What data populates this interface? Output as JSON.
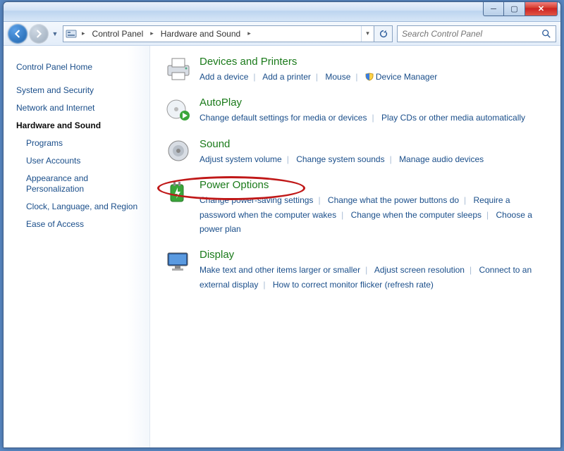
{
  "window": {
    "min": "─",
    "max": "▢",
    "close": "✕"
  },
  "address": {
    "seg1": "Control Panel",
    "seg2": "Hardware and Sound"
  },
  "search": {
    "placeholder": "Search Control Panel"
  },
  "sidebar": {
    "home": "Control Panel Home",
    "items": [
      "System and Security",
      "Network and Internet",
      "Hardware and Sound",
      "Programs",
      "User Accounts",
      "Appearance and Personalization",
      "Clock, Language, and Region",
      "Ease of Access"
    ]
  },
  "categories": [
    {
      "title": "Devices and Printers",
      "tasks": [
        "Add a device",
        "Add a printer",
        "Mouse",
        "Device Manager"
      ],
      "shield_on": [
        3
      ]
    },
    {
      "title": "AutoPlay",
      "tasks": [
        "Change default settings for media or devices",
        "Play CDs or other media automatically"
      ]
    },
    {
      "title": "Sound",
      "tasks": [
        "Adjust system volume",
        "Change system sounds",
        "Manage audio devices"
      ]
    },
    {
      "title": "Power Options",
      "tasks": [
        "Change power-saving settings",
        "Change what the power buttons do",
        "Require a password when the computer wakes",
        "Change when the computer sleeps",
        "Choose a power plan"
      ],
      "highlight": true
    },
    {
      "title": "Display",
      "tasks": [
        "Make text and other items larger or smaller",
        "Adjust screen resolution",
        "Connect to an external display",
        "How to correct monitor flicker (refresh rate)"
      ]
    }
  ]
}
